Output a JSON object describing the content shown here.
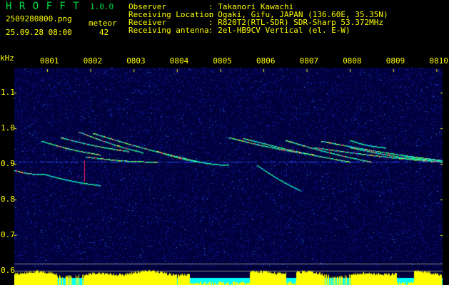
{
  "app": {
    "title": "H R O F F T",
    "version": "1.0.0"
  },
  "file": {
    "name": "2509280800.png",
    "datetime": "25.09.28 08:00"
  },
  "meteor": {
    "label": "meteor",
    "count": "42"
  },
  "info": [
    {
      "label": "Observer",
      "value": ": Takanori Kawachi"
    },
    {
      "label": "Receiving Location",
      "value": ": Ogaki, Gifu, JAPAN (136.60E, 35.35N)"
    },
    {
      "label": "Receiver",
      "value": ": R820T2(RTL-SDR) SDR-Sharp 53.372MHz"
    },
    {
      "label": "Receiving antenna",
      "value": ": 2el-HB9CV Vertical (el. E-W)"
    }
  ],
  "axis": {
    "unit": "kHz",
    "y_ticks": [
      "1.1",
      "1.0",
      "0.9",
      "0.8",
      "0.7",
      "0.6"
    ],
    "x_ticks": [
      "0801",
      "0802",
      "0803",
      "0804",
      "0805",
      "0806",
      "0807",
      "0808",
      "0809",
      "0810"
    ]
  },
  "colors": {
    "text": "#ffff00",
    "title": "#00e040",
    "background": "#000010",
    "signal_bar": "#ffff00",
    "noise_bar": "#00ffff"
  }
}
